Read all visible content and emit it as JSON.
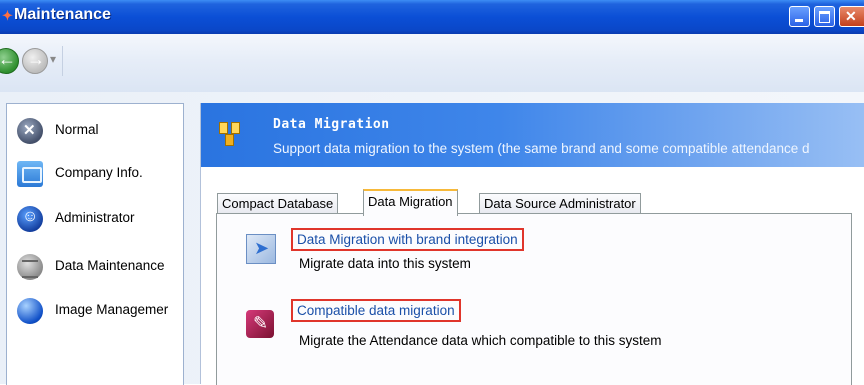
{
  "window": {
    "title": "Maintenance"
  },
  "sidebar": {
    "items": [
      {
        "label": "Normal",
        "icon": "normal-icon"
      },
      {
        "label": "Company Info.",
        "icon": "company-info-icon"
      },
      {
        "label": "Administrator",
        "icon": "administrator-icon"
      },
      {
        "label": "Data Maintenance",
        "icon": "data-maintenance-icon"
      },
      {
        "label": "Image Managemer",
        "icon": "image-management-icon"
      }
    ]
  },
  "banner": {
    "title": "Data Migration",
    "subtitle": "Support data migration to the system (the same brand and some compatible  attendance d"
  },
  "tabs": [
    {
      "label": "Compact Database",
      "active": false
    },
    {
      "label": "Data Migration",
      "active": true
    },
    {
      "label": "Data Source Administrator",
      "active": false
    }
  ],
  "items": [
    {
      "title": "Data Migration with brand integration",
      "description": "Migrate data into this system",
      "icon": "brand-migration-icon"
    },
    {
      "title": "Compatible  data migration",
      "description": "Migrate the Attendance data which compatible   to this system",
      "icon": "compatible-migration-icon"
    }
  ],
  "colors": {
    "titlebar": "#0b4fd6",
    "banner": "#3f86ea",
    "link": "#1a4fa8",
    "highlight": "#e0352b",
    "tab_active_accent": "#f7b93a"
  }
}
